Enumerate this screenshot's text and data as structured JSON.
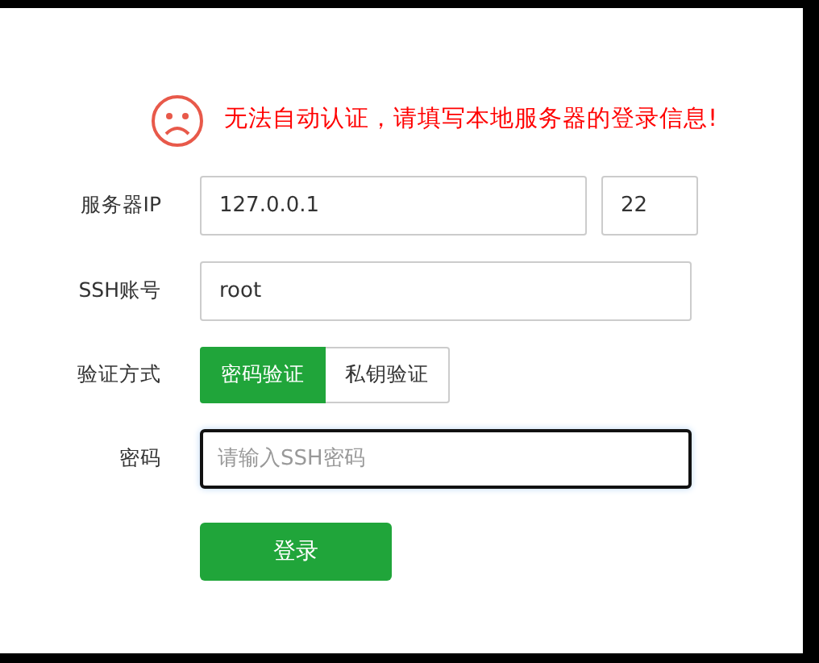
{
  "alert": {
    "message": "无法自动认证，请填写本地服务器的登录信息!"
  },
  "form": [
    {
      "kind": "ip",
      "label": "服务器IP",
      "value": "127.0.0.1",
      "port": "22"
    },
    {
      "kind": "text",
      "label": "SSH账号",
      "value": "root"
    },
    {
      "kind": "toggle",
      "label": "验证方式",
      "options": [
        {
          "label": "密码验证",
          "selected": true
        },
        {
          "label": "私钥验证",
          "selected": false
        }
      ]
    },
    {
      "kind": "password",
      "label": "密码",
      "placeholder": "请输入SSH密码",
      "focused": true
    }
  ],
  "submit": {
    "label": "登录"
  }
}
